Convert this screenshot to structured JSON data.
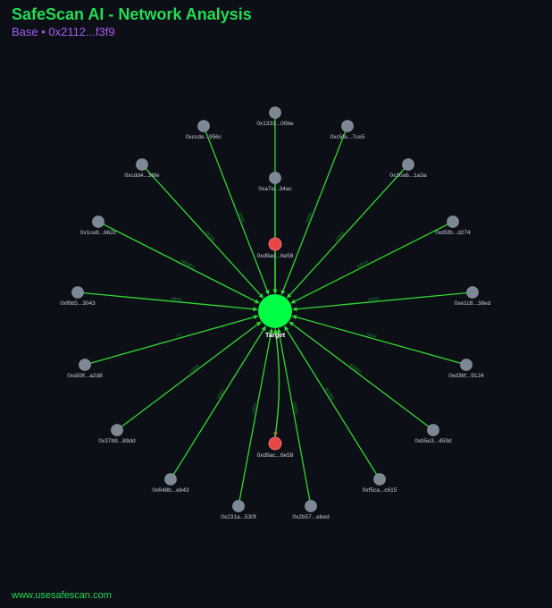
{
  "header": {
    "title": "SafeScan AI - Network Analysis",
    "subtitle": "Base • 0x2112...f3f9"
  },
  "footer": {
    "url": "www.usesafescan.com"
  },
  "colors": {
    "edge": "#2fd82f",
    "edge_risk": "#e03c3c",
    "target": "#00ff44",
    "flagged_node": "#e84545",
    "node": "#7d8894"
  },
  "graph": {
    "target": {
      "id": "target",
      "label": "Target"
    },
    "nodes": [
      {
        "id": "n1",
        "label": "0x1331...00be",
        "kind": "normal"
      },
      {
        "id": "n2",
        "label": "0xc5fe...7ce5",
        "kind": "normal"
      },
      {
        "id": "n3",
        "label": "0x30a6...1a3a",
        "kind": "normal"
      },
      {
        "id": "n4",
        "label": "0xd5fb...d274",
        "kind": "normal"
      },
      {
        "id": "n5",
        "label": "0xe1c8...38ed",
        "kind": "normal"
      },
      {
        "id": "n6",
        "label": "0xd36f...9124",
        "kind": "normal"
      },
      {
        "id": "n7",
        "label": "0xb5e3...459d",
        "kind": "normal"
      },
      {
        "id": "n8",
        "label": "0xf5ca...c615",
        "kind": "normal"
      },
      {
        "id": "n9",
        "label": "0x2b57...ebed",
        "kind": "normal"
      },
      {
        "id": "n10",
        "label": "0x231a...530f",
        "kind": "normal"
      },
      {
        "id": "n11",
        "label": "0x648b...eb43",
        "kind": "normal"
      },
      {
        "id": "n12",
        "label": "0x37b9...89dd",
        "kind": "normal"
      },
      {
        "id": "n13",
        "label": "0xa59f...a2d8",
        "kind": "normal"
      },
      {
        "id": "n14",
        "label": "0xf6b5...3043",
        "kind": "normal"
      },
      {
        "id": "n15",
        "label": "0x1ce8...662c",
        "kind": "normal"
      },
      {
        "id": "n16",
        "label": "0xcdd4...36fe",
        "kind": "normal"
      },
      {
        "id": "n17",
        "label": "0xccde...956c",
        "kind": "normal"
      },
      {
        "id": "n18",
        "label": "0xa7e...34ac",
        "kind": "normal"
      },
      {
        "id": "n19",
        "label": "0xd9ac...6e58",
        "kind": "flagged"
      },
      {
        "id": "n20",
        "label": "0xd9ac...6e58",
        "kind": "flagged"
      }
    ],
    "edges": [
      {
        "from": "n1",
        "to": "target",
        "label": ""
      },
      {
        "from": "n2",
        "to": "target",
        "label": "USDC"
      },
      {
        "from": "n3",
        "to": "target",
        "label": "USDC"
      },
      {
        "from": "n4",
        "to": "target",
        "label": "WETH"
      },
      {
        "from": "n5",
        "to": "target",
        "label": "SOOS"
      },
      {
        "from": "n6",
        "to": "target",
        "label": "HIGH"
      },
      {
        "from": "n7",
        "to": "target",
        "label": "BASED"
      },
      {
        "from": "n8",
        "to": "target",
        "label": "BASED"
      },
      {
        "from": "n9",
        "to": "target",
        "label": "USDbC"
      },
      {
        "from": "n10",
        "to": "target",
        "label": "USDC"
      },
      {
        "from": "n11",
        "to": "target",
        "label": "USDC"
      },
      {
        "from": "n12",
        "to": "target",
        "label": "USDC"
      },
      {
        "from": "n13",
        "to": "target",
        "label": "FT"
      },
      {
        "from": "n14",
        "to": "target",
        "label": "WIRE"
      },
      {
        "from": "n15",
        "to": "target",
        "label": "MEMES"
      },
      {
        "from": "n16",
        "to": "target",
        "label": "DOGE"
      },
      {
        "from": "n17",
        "to": "target",
        "label": "USDC"
      },
      {
        "from": "n18",
        "to": "target",
        "label": ""
      },
      {
        "from": "n19",
        "to": "target",
        "label": ""
      },
      {
        "from": "target",
        "to": "n20",
        "label": "",
        "risk": true
      },
      {
        "from": "n20",
        "to": "target",
        "label": ""
      }
    ]
  }
}
